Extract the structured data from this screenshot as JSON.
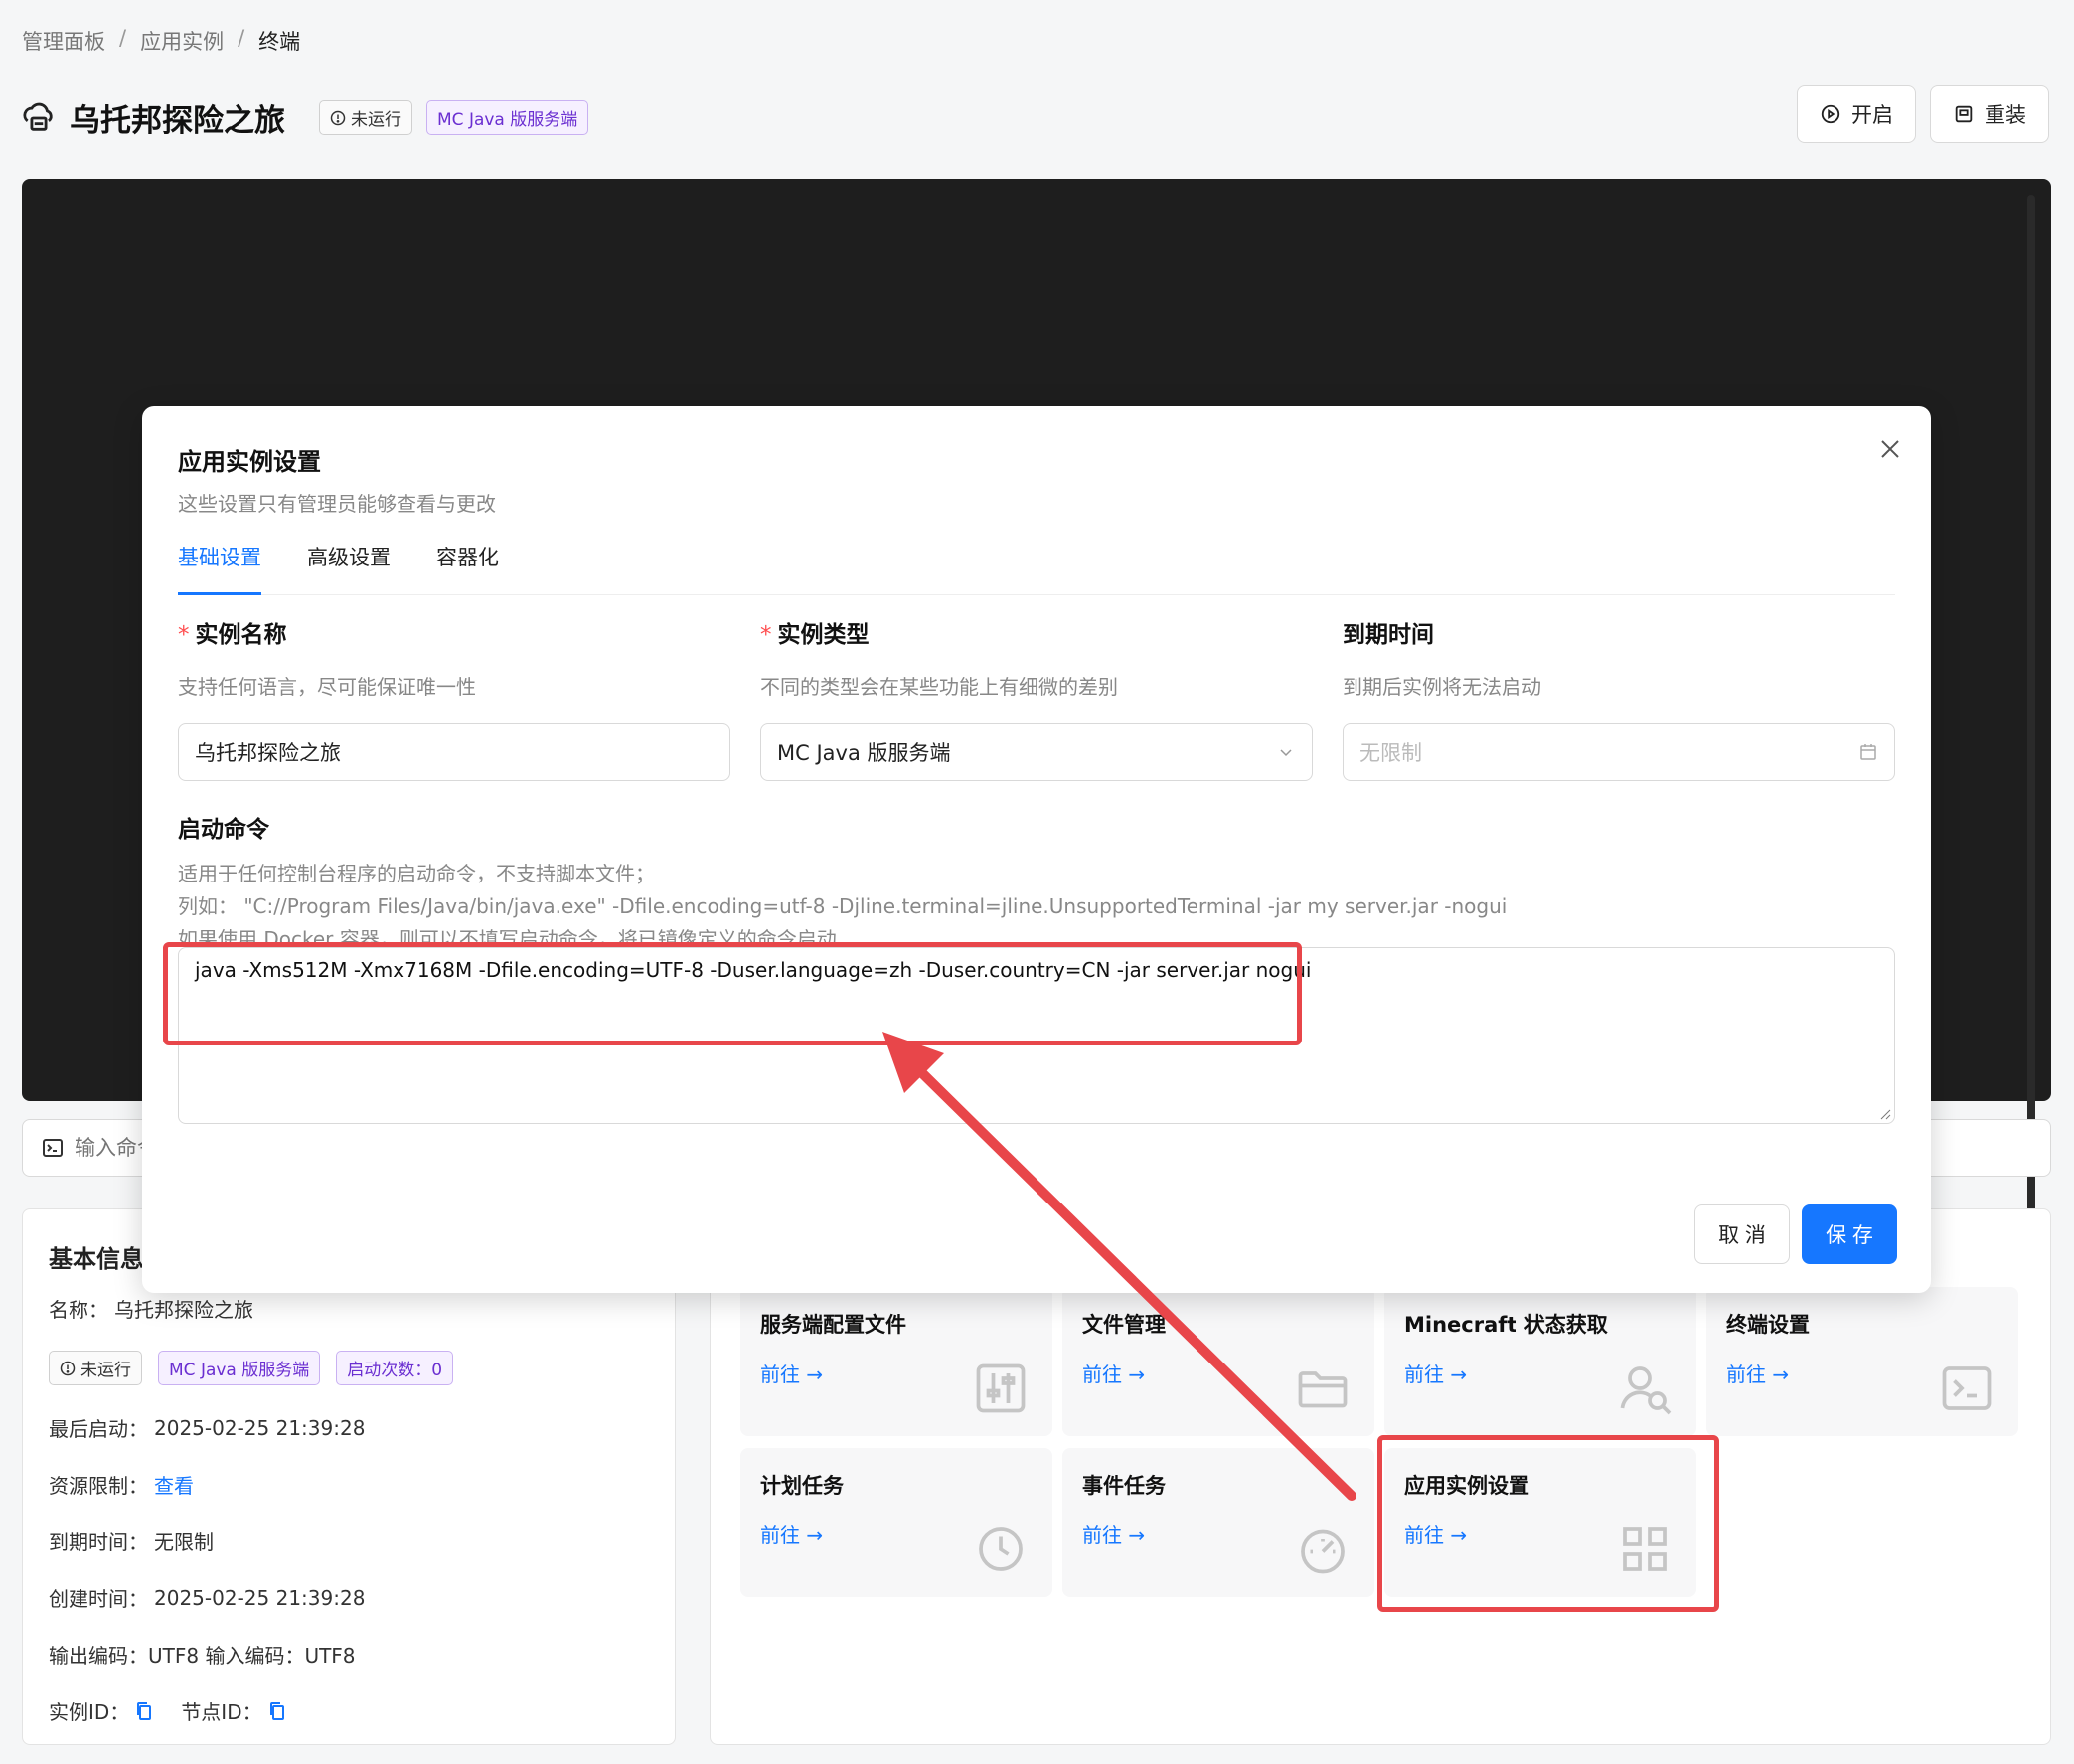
{
  "breadcrumb": [
    "管理面板",
    "应用实例",
    "终端"
  ],
  "breadcrumb_sep": "/",
  "header": {
    "title": "乌托邦探险之旅",
    "status_tag": "未运行",
    "type_tag": "MC Java 版服务端",
    "start_label": "开启",
    "reinstall_label": "重装"
  },
  "command_input": {
    "placeholder": "输入命令"
  },
  "info_card": {
    "title": "基本信息",
    "name_label": "名称：",
    "name_value": "乌托邦探险之旅",
    "tags": {
      "status": "未运行",
      "type": "MC Java 版服务端",
      "starts": "启动次数：0"
    },
    "last_start_label": "最后启动：",
    "last_start_value": "2025-02-25 21:39:28",
    "resource_label": "资源限制：",
    "resource_link": "查看",
    "expire_label": "到期时间：",
    "expire_value": "无限制",
    "created_label": "创建时间：",
    "created_value": "2025-02-25 21:39:28",
    "encoding_text": "输出编码：UTF8  输入编码：UTF8",
    "instance_id_label": "实例ID：",
    "node_id_label": "节点ID："
  },
  "features": [
    {
      "title": "服务端配置文件",
      "go": "前往 →",
      "icon": "sliders-icon"
    },
    {
      "title": "文件管理",
      "go": "前往 →",
      "icon": "folder-icon"
    },
    {
      "title": "Minecraft 状态获取",
      "go": "前往 →",
      "icon": "user-search-icon"
    },
    {
      "title": "终端设置",
      "go": "前往 →",
      "icon": "terminal-icon"
    },
    {
      "title": "计划任务",
      "go": "前往 →",
      "icon": "clock-icon"
    },
    {
      "title": "事件任务",
      "go": "前往 →",
      "icon": "gauge-icon"
    },
    {
      "title": "应用实例设置",
      "go": "前往 →",
      "icon": "grid-icon"
    }
  ],
  "modal": {
    "title": "应用实例设置",
    "subtitle": "这些设置只有管理员能够查看与更改",
    "tabs": [
      "基础设置",
      "高级设置",
      "容器化"
    ],
    "name_field": {
      "label": "实例名称",
      "help": "支持任何语言，尽可能保证唯一性",
      "value": "乌托邦探险之旅"
    },
    "type_field": {
      "label": "实例类型",
      "help": "不同的类型会在某些功能上有细微的差别",
      "value": "MC Java 版服务端"
    },
    "expire_field": {
      "label": "到期时间",
      "help": "到期后实例将无法启动",
      "placeholder": "无限制"
    },
    "cmd_field": {
      "label": "启动命令",
      "help1": "适用于任何控制台程序的启动命令，不支持脚本文件；",
      "help2": "列如：  \"C://Program Files/Java/bin/java.exe\" -Dfile.encoding=utf-8 -Djline.terminal=jline.UnsupportedTerminal -jar my server.jar -nogui",
      "help3": "如果使用 Docker 容器，则可以不填写启动命令，将已镜像定义的命令启动",
      "value": "java -Xms512M -Xmx7168M -Dfile.encoding=UTF-8 -Duser.language=zh -Duser.country=CN -jar server.jar nogui"
    },
    "cancel_label": "取 消",
    "save_label": "保 存"
  },
  "colors": {
    "accent": "#1677ff",
    "annotation": "#e8464a",
    "terminal_bg": "#1e1e1e"
  }
}
